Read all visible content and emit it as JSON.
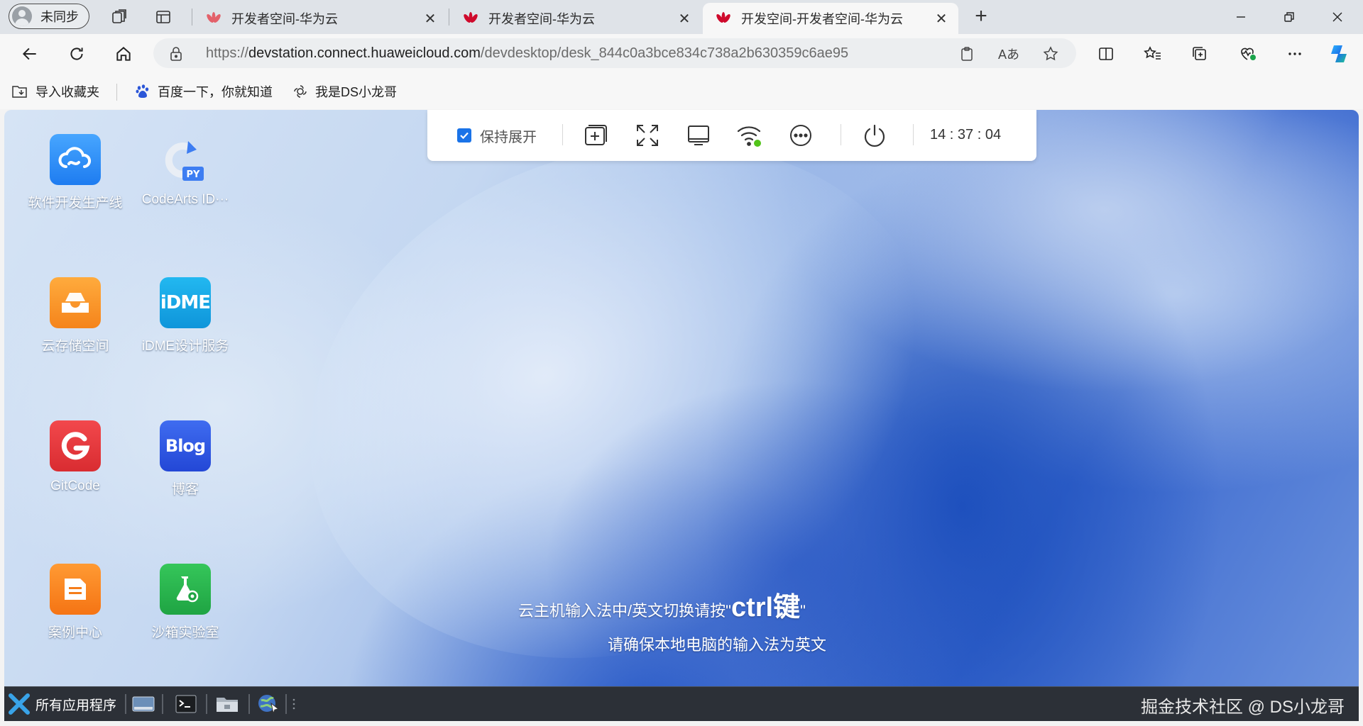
{
  "browser": {
    "profile_label": "未同步",
    "tabs": [
      {
        "title": "开发者空间-华为云",
        "active": false
      },
      {
        "title": "开发者空间-华为云",
        "active": false
      },
      {
        "title": "开发空间-开发者空间-华为云",
        "active": true
      }
    ],
    "new_tab_symbol": "+",
    "address": {
      "scheme": "https://",
      "host": "devstation.connect.huaweicloud.com",
      "path": "/devdesktop/desk_844c0a3bce834c738a2b630359c6ae95"
    },
    "favorites": [
      {
        "label": "导入收藏夹",
        "icon": "folder-import-icon"
      },
      {
        "label": "百度一下，你就知道",
        "icon": "baidu-paw-icon"
      },
      {
        "label": "我是DS小龙哥",
        "icon": "openai-knot-icon"
      }
    ],
    "colors": {
      "accent": "#1a73e8",
      "tab_strip": "#dfe3e8",
      "toolbar": "#f7f7f7"
    }
  },
  "desktop": {
    "apps": [
      {
        "label": "软件开发生产线",
        "icon": "devops-cloud-icon",
        "color": "#2d8cf0"
      },
      {
        "label": "CodeArts ID···",
        "icon": "codearts-py-icon",
        "color": "#ffffff"
      },
      {
        "label": "云存储空间",
        "icon": "cloud-storage-icon",
        "color": "#f7941d"
      },
      {
        "label": "iDME设计服务",
        "icon": "idme-icon",
        "color": "#19a8e6"
      },
      {
        "label": "GitCode",
        "icon": "gitcode-icon",
        "color": "#e5353a"
      },
      {
        "label": "博客",
        "icon": "blog-icon",
        "color": "#2f5ee8"
      },
      {
        "label": "案例中心",
        "icon": "case-center-icon",
        "color": "#f7861d"
      },
      {
        "label": "沙箱实验室",
        "icon": "sandbox-lab-icon",
        "color": "#27b34a"
      }
    ],
    "control_bar": {
      "keep_expanded_label": "保持展开",
      "keep_expanded_checked": true,
      "clock": "14 : 37 : 04"
    },
    "hint": {
      "line1_prefix": "云主机输入法中/英文切换请按\"",
      "line1_key": "ctrl键",
      "line1_suffix": "\"",
      "line2": "请确保本地电脑的输入法为英文"
    },
    "taskbar": {
      "start_label": "所有应用程序",
      "watermark": "掘金技术社区 @ DS小龙哥"
    }
  }
}
